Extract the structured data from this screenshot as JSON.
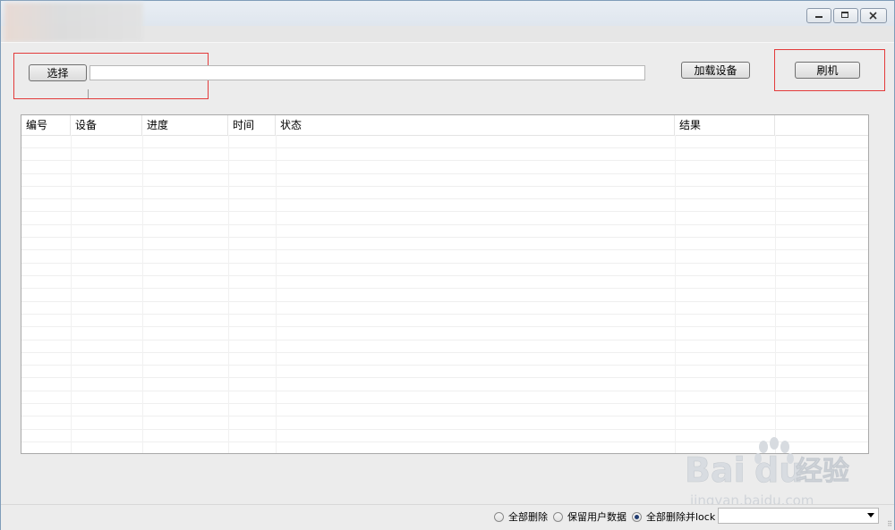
{
  "toolbar": {
    "select_label": "选择",
    "path_value": "",
    "load_device_label": "加载设备",
    "flash_label": "刷机"
  },
  "table": {
    "columns": [
      "编号",
      "设备",
      "进度",
      "时间",
      "状态",
      "结果"
    ],
    "rows": []
  },
  "status": {
    "options": [
      "全部删除",
      "保留用户数据",
      "全部删除并lock"
    ],
    "selected": "全部删除并lock",
    "combo_value": ""
  },
  "watermark": {
    "brand": "Bai",
    "brand2": "du",
    "suffix": "经验",
    "url": "jingyan.baidu.com"
  },
  "colors": {
    "highlight_box": "#e33b3b",
    "window_border": "#7f9db9"
  },
  "icons": [
    "minimize-icon",
    "maximize-icon",
    "close-icon",
    "dropdown-arrow-icon",
    "resize-grip-icon",
    "baidu-paw-icon"
  ]
}
